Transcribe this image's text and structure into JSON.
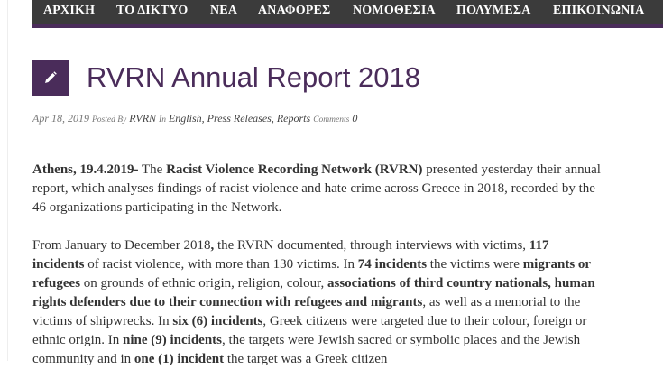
{
  "nav": {
    "items": [
      "ΑΡΧΙΚΗ",
      "ΤΟ ΔΙΚΤΥΟ",
      "ΝΕΑ",
      "ΑΝΑΦΟΡΕΣ",
      "ΝΟΜΟΘΕΣΙΑ",
      "ΠΟΛΥΜΕΣΑ",
      "ΕΠΙΚΟΙΝΩΝΙΑ"
    ]
  },
  "colors": {
    "accent": "#4a2c5a",
    "nav_bg": "#3b3b3b"
  },
  "post": {
    "icon": "pencil-icon",
    "title": "RVRN Annual Report 2018",
    "meta": {
      "date": "Apr 18, 2019",
      "posted_by_label": "Posted By",
      "author": "RVRN",
      "in_label": "In",
      "categories": [
        "English",
        "Press Releases",
        "Reports"
      ],
      "comments_label": "Comments",
      "comments_count": "0"
    },
    "p1": {
      "s1": "Athens, 19.4.2019-",
      "s2": " The ",
      "s3": "Racist Violence Recording Network (RVRN)",
      "s4": " presented yesterday their annual report, which analyses findings of racist violence and hate crime across Greece in 2018, recorded by the 46 organizations participating in the Network."
    },
    "p2": {
      "s1": "From January to December 2018",
      "s2": ",",
      "s3": " the RVRN documented, through interviews with victims, ",
      "s4": "117 incidents",
      "s5": " of racist violence, with more than 130 victims. In ",
      "s6": "74 incidents",
      "s7": " the victims were ",
      "s8": "migrants or refugees",
      "s9": " on grounds of ethnic origin, religion, colour, ",
      "s10": "associations of third country nationals, human rights defenders due to their connection with refugees and migrants",
      "s11": ", as well as a memorial to the victims of shipwrecks. In ",
      "s12": "six (6) incidents",
      "s13": ", Greek citizens were targeted due to their colour, foreign or ethnic origin. In ",
      "s14": "nine (9) incidents",
      "s15": ", the targets were Jewish sacred or symbolic places and the Jewish community and in ",
      "s16": "one (1) incident",
      "s17": " the target was a Greek citizen"
    }
  }
}
